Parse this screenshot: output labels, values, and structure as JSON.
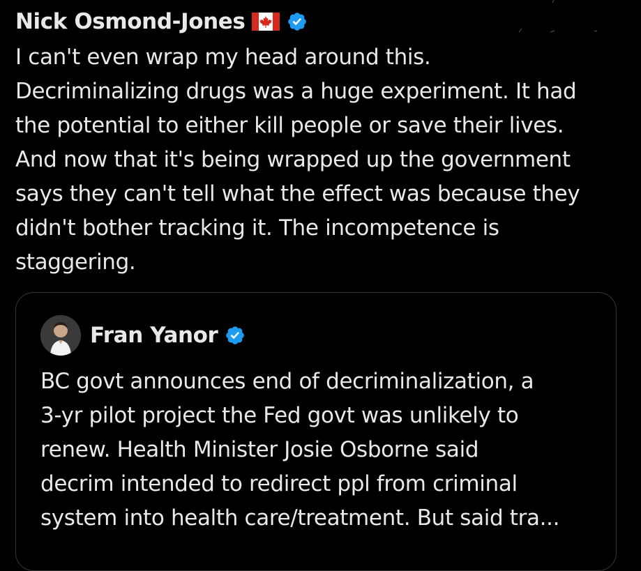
{
  "post": {
    "author_name": "Nick Osmond-Jones",
    "flag_icon": "canada-flag-icon",
    "verified_icon": "verified-badge-icon",
    "text_lines": [
      "I can't even wrap my head around this.",
      "Decriminalizing drugs was a huge experiment. It had",
      "the potential to either kill people or save their lives.",
      "And now that it's being wrapped up the government",
      "says they can't tell what the effect was because they",
      "didn't bother tracking it. The incompetence is",
      "staggering."
    ]
  },
  "quoted_post": {
    "author_name": "Fran Yanor",
    "verified_icon": "verified-badge-icon",
    "text_lines": [
      "BC govt announces end of decriminalization, a",
      "3-yr pilot project the Fed govt was unlikely to",
      "renew. Health Minister Josie Osborne said",
      "decrim intended to redirect ppl from criminal",
      "system into health care/treatment. But said tra..."
    ]
  },
  "colors": {
    "background": "#000000",
    "text": "#e7e9ea",
    "border": "#333639",
    "verified_blue": "#1d9bf0",
    "flag_red": "#d52b1e"
  }
}
